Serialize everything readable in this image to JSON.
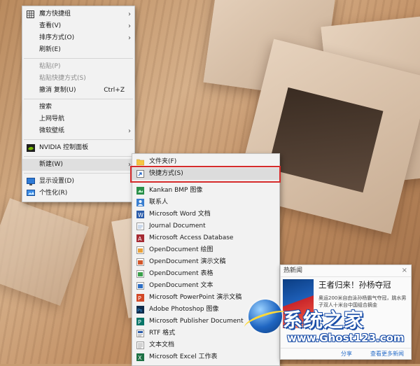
{
  "context_menu": {
    "items": [
      {
        "label": "魔方快捷组",
        "has_submenu": true,
        "icon": "grid-icon"
      },
      {
        "label": "查看(V)",
        "has_submenu": true
      },
      {
        "label": "排序方式(O)",
        "has_submenu": true
      },
      {
        "label": "刷新(E)"
      },
      {
        "label": "粘贴(P)",
        "disabled": true
      },
      {
        "label": "粘贴快捷方式(S)",
        "disabled": true
      },
      {
        "label": "撤消 复制(U)",
        "shortcut": "Ctrl+Z"
      },
      {
        "label": "搜索"
      },
      {
        "label": "上网导航"
      },
      {
        "label": "微软壁纸",
        "has_submenu": true
      },
      {
        "label": "NVIDIA 控制面板",
        "icon": "nvidia-icon"
      },
      {
        "label": "新建(W)",
        "has_submenu": true,
        "hovered": true
      },
      {
        "label": "显示设置(D)",
        "icon": "display-icon"
      },
      {
        "label": "个性化(R)",
        "icon": "personalize-icon"
      }
    ]
  },
  "new_submenu": {
    "items": [
      {
        "label": "文件夹(F)",
        "icon": "folder-icon"
      },
      {
        "label": "快捷方式(S)",
        "icon": "shortcut-icon",
        "highlighted": true
      },
      {
        "label": "Kankan BMP 图像",
        "icon": "bmp-icon"
      },
      {
        "label": "联系人",
        "icon": "contact-icon"
      },
      {
        "label": "Microsoft Word 文档",
        "icon": "word-icon"
      },
      {
        "label": "Journal Document",
        "icon": "journal-icon"
      },
      {
        "label": "Microsoft Access Database",
        "icon": "access-icon"
      },
      {
        "label": "OpenDocument 绘图",
        "icon": "odg-icon"
      },
      {
        "label": "OpenDocument 演示文稿",
        "icon": "odp-icon"
      },
      {
        "label": "OpenDocument 表格",
        "icon": "ods-icon"
      },
      {
        "label": "OpenDocument 文本",
        "icon": "odt-icon"
      },
      {
        "label": "Microsoft PowerPoint 演示文稿",
        "icon": "powerpoint-icon"
      },
      {
        "label": "Adobe Photoshop 图像",
        "icon": "photoshop-icon"
      },
      {
        "label": "Microsoft Publisher Document",
        "icon": "publisher-icon"
      },
      {
        "label": "RTF 格式",
        "icon": "rtf-icon"
      },
      {
        "label": "文本文档",
        "icon": "txt-icon"
      },
      {
        "label": "Microsoft Excel 工作表",
        "icon": "excel-icon"
      }
    ]
  },
  "news": {
    "header": "热新闻",
    "close": "×",
    "title": "王者归来！孙杨夺冠",
    "text": "奥运200米自由泳孙杨霸气夺冠，跳水男子双人十米台中国组合摘金",
    "share": "分享",
    "more": "查看更多新闻"
  },
  "watermark": {
    "brand": "系统之家",
    "url": "www.Ghost123.com"
  },
  "colors": {
    "menu_bg": "#f2f2f2",
    "highlight_border": "#d52b2b",
    "link": "#2a6fc9"
  }
}
